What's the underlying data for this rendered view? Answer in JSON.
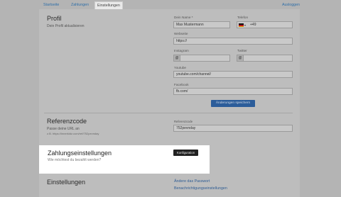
{
  "nav": {
    "tabs": [
      {
        "label": "Startseite"
      },
      {
        "label": "Zahlungen"
      },
      {
        "label": "Einstellungen"
      }
    ],
    "logout_label": "Ausloggen"
  },
  "profile": {
    "title": "Profil",
    "subtitle": "Dein Profil aktualisieren",
    "name_label": "Dein Name *",
    "name_value": "Max Mustermann",
    "phone_label": "Telefon",
    "phone_prefix": "+49",
    "website_label": "Webseite",
    "website_value": "https://",
    "instagram_label": "Instagram",
    "instagram_prefix": "@",
    "twitter_label": "Twitter",
    "twitter_prefix": "@",
    "youtube_label": "Youtube",
    "youtube_value": "youtube.com/channel/",
    "facebook_label": "Facebook",
    "facebook_value": "fb.com/",
    "save_label": "Änderungen speichern"
  },
  "referral": {
    "title": "Referenzcode",
    "subtitle_line1": "Passe deine URL an",
    "subtitle_line2": "z.B. https://innerkidz.com/ref/752pevnday",
    "field_label": "Referenzcode",
    "field_value": "752pevnday"
  },
  "payment": {
    "title": "Zahlungseinstellungen",
    "subtitle": "Wie möchtest du bezahlt werden?",
    "config_label": "Konfiguration"
  },
  "settings": {
    "title": "Einstellungen",
    "change_password_label": "Ändere das Passwort",
    "notifications_label": "Benachrichtigungseinstellungen"
  }
}
